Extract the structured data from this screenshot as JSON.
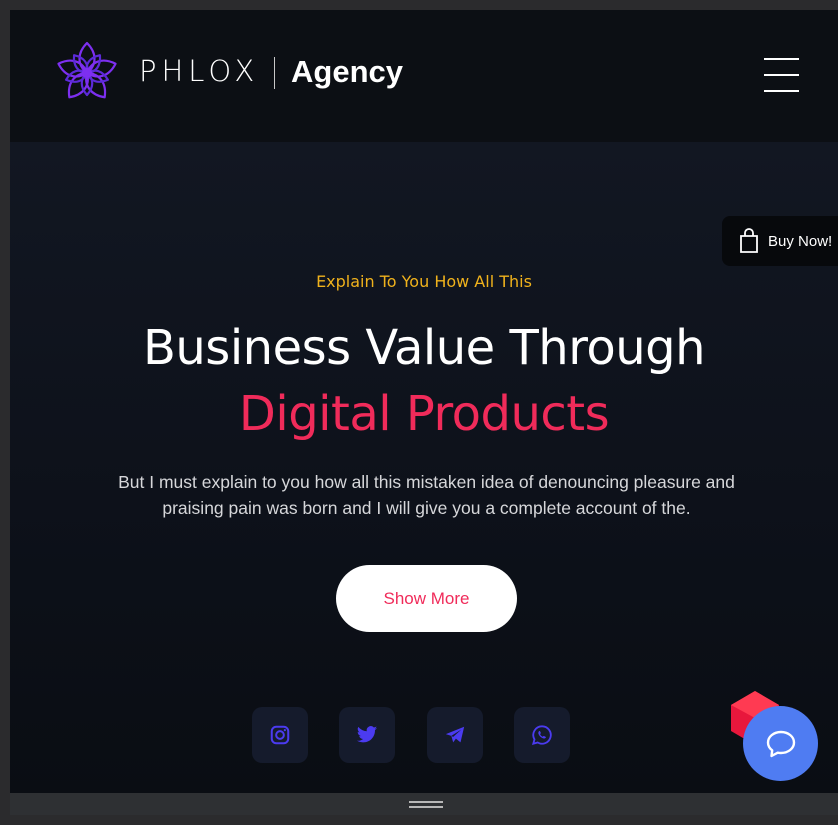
{
  "header": {
    "brand": "PHLOX",
    "brand_sub": "Agency",
    "logo_icon": "lotus-logo-icon",
    "menu_icon": "hamburger-menu-icon"
  },
  "buy_now": {
    "label": "Buy Now!",
    "icon": "shopping-bag-icon"
  },
  "hero": {
    "eyebrow": "Explain To You How All This",
    "title_line1": "Business Value Through",
    "title_line2": "Digital Products",
    "description": "But I must explain to you how all this mistaken idea of denouncing pleasure and praising pain was born and I will give you a complete account of the.",
    "cta_label": "Show More"
  },
  "social": [
    {
      "name": "instagram-icon"
    },
    {
      "name": "twitter-icon"
    },
    {
      "name": "telegram-icon"
    },
    {
      "name": "whatsapp-icon"
    }
  ],
  "colors": {
    "accent_pink": "#f02b5a",
    "accent_yellow": "#f0b21c",
    "social_icon": "#4b3bf0",
    "chat_button": "#4f7cf2",
    "logo_purple": "#7d2ff0"
  },
  "chat": {
    "icon": "chat-bubble-icon"
  }
}
